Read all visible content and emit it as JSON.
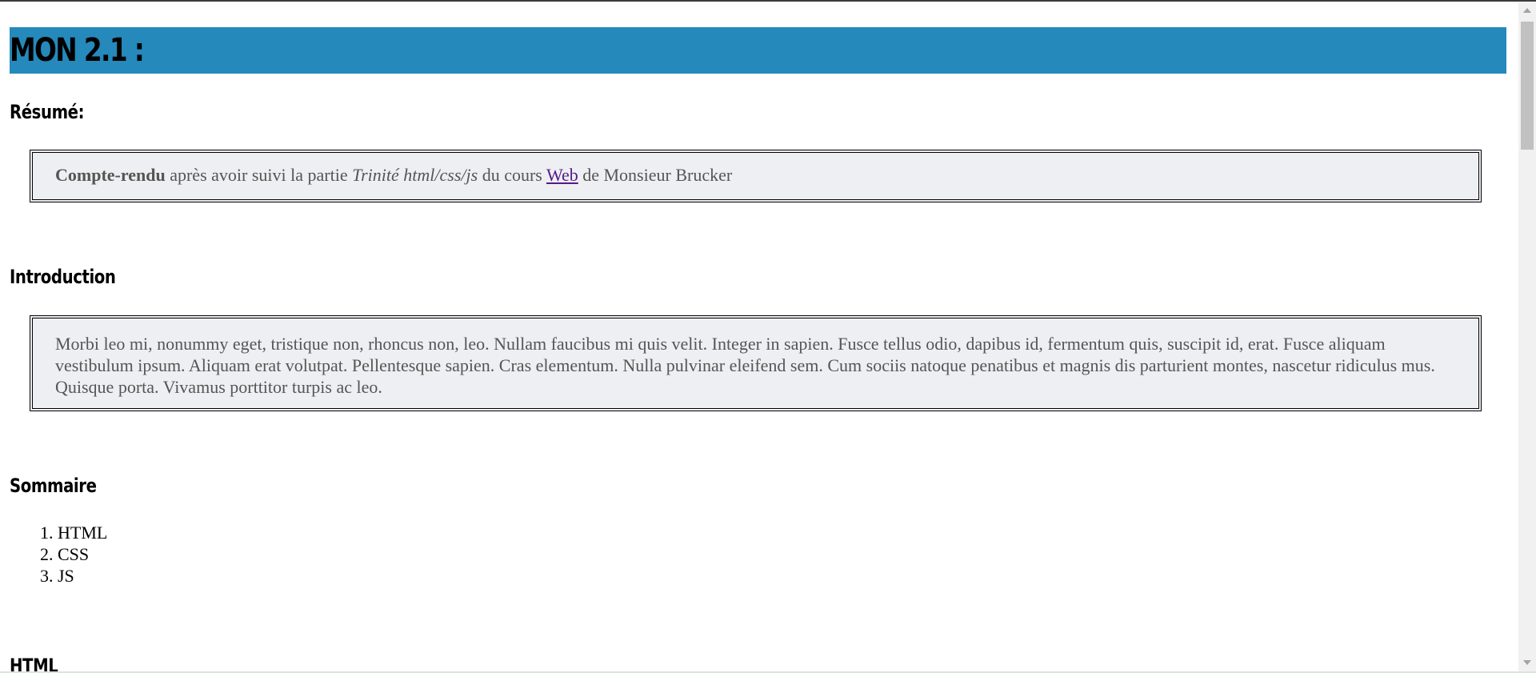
{
  "header": {
    "title": "MON 2.1 :"
  },
  "resume": {
    "heading": "Résumé:",
    "bold": "Compte-rendu",
    "text1": " après avoir suivi la partie ",
    "italic": "Trinité html/css/js",
    "text2": " du cours ",
    "link": "Web",
    "text3": " de Monsieur Brucker"
  },
  "introduction": {
    "heading": "Introduction",
    "body": "Morbi leo mi, nonummy eget, tristique non, rhoncus non, leo. Nullam faucibus mi quis velit. Integer in sapien. Fusce tellus odio, dapibus id, fermentum quis, suscipit id, erat. Fusce aliquam vestibulum ipsum. Aliquam erat volutpat. Pellentesque sapien. Cras elementum. Nulla pulvinar eleifend sem. Cum sociis natoque penatibus et magnis dis parturient montes, nascetur ridiculus mus. Quisque porta. Vivamus porttitor turpis ac leo."
  },
  "sommaire": {
    "heading": "Sommaire",
    "items": [
      "HTML",
      "CSS",
      "JS"
    ]
  },
  "html_section": {
    "heading": "HTML"
  },
  "colors": {
    "title_bar": "#2589bb",
    "box_bg": "#eeeff2",
    "link": "#551a8b"
  },
  "scrollbar": {
    "up_icon": "arrow-up-icon",
    "down_icon": "arrow-down-icon"
  }
}
